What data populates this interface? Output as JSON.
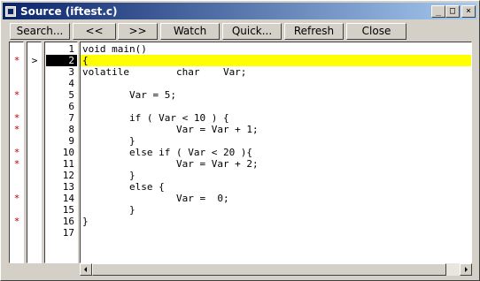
{
  "window": {
    "title": "Source (iftest.c)",
    "controls": {
      "minimize": "_",
      "maximize": "□",
      "close": "×"
    }
  },
  "toolbar": {
    "search": "Search...",
    "back": "<<",
    "forward": ">>",
    "watch": "Watch",
    "quick": "Quick...",
    "refresh": "Refresh",
    "close": "Close"
  },
  "editor": {
    "current_line": 2,
    "breakpoint_marker": "*",
    "pointer_marker": ">",
    "lines": [
      {
        "num": "1",
        "code": "void main()",
        "bp": false
      },
      {
        "num": "2",
        "code": "{",
        "bp": true
      },
      {
        "num": "3",
        "code": "volatile        char    Var;",
        "bp": false
      },
      {
        "num": "4",
        "code": "",
        "bp": false
      },
      {
        "num": "5",
        "code": "        Var = 5;",
        "bp": true
      },
      {
        "num": "6",
        "code": "",
        "bp": false
      },
      {
        "num": "7",
        "code": "        if ( Var < 10 ) {",
        "bp": true
      },
      {
        "num": "8",
        "code": "                Var = Var + 1;",
        "bp": true
      },
      {
        "num": "9",
        "code": "        }",
        "bp": false
      },
      {
        "num": "10",
        "code": "        else if ( Var < 20 ){",
        "bp": true
      },
      {
        "num": "11",
        "code": "                Var = Var + 2;",
        "bp": true
      },
      {
        "num": "12",
        "code": "        }",
        "bp": false
      },
      {
        "num": "13",
        "code": "        else {",
        "bp": false
      },
      {
        "num": "14",
        "code": "                Var =  0;",
        "bp": true
      },
      {
        "num": "15",
        "code": "        }",
        "bp": false
      },
      {
        "num": "16",
        "code": "}",
        "bp": true
      },
      {
        "num": "17",
        "code": "",
        "bp": false
      }
    ]
  },
  "colors": {
    "titlebar_start": "#0a246a",
    "titlebar_end": "#a6caf0",
    "highlight": "#ffff00",
    "breakpoint": "#c00000",
    "face": "#d4d0c8"
  },
  "icons": {
    "app": "window-icon",
    "scroll_left": "arrow-left-icon",
    "scroll_right": "arrow-right-icon"
  }
}
